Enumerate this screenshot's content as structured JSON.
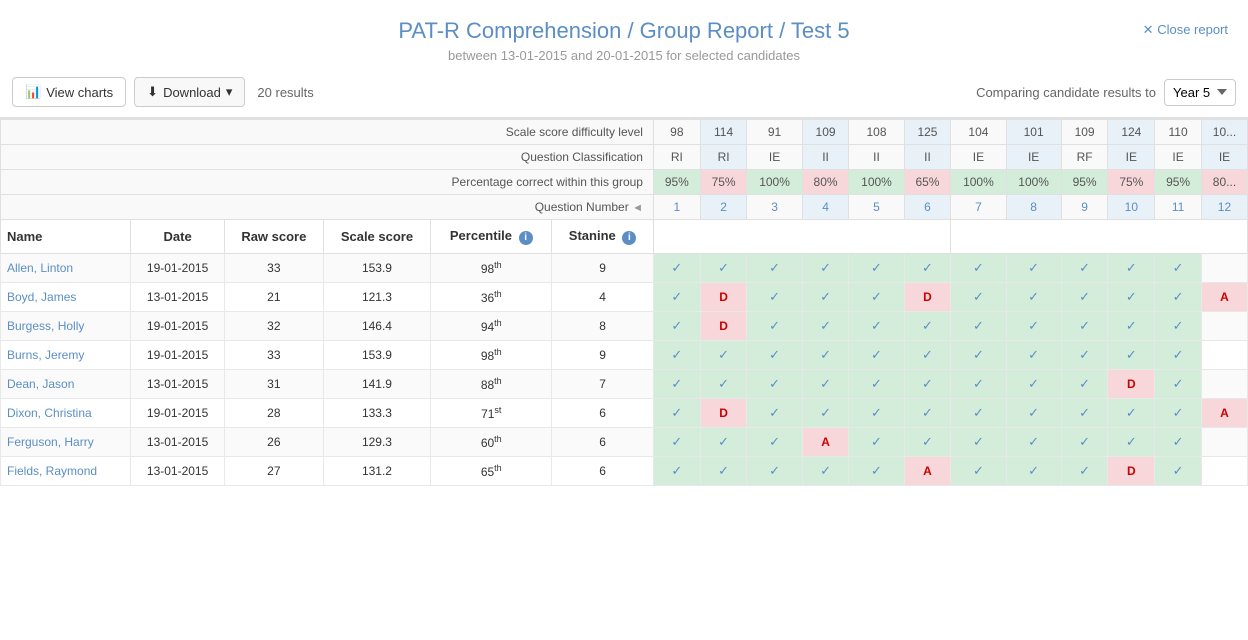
{
  "header": {
    "title": "PAT-R Comprehension / Group Report / Test 5",
    "subtitle": "between 13-01-2015 and 20-01-2015 for selected candidates",
    "close_label": "Close report"
  },
  "toolbar": {
    "view_charts_label": "View charts",
    "download_label": "Download",
    "results_count": "20 results",
    "compare_label": "Comparing candidate results to",
    "compare_value": "Year 5"
  },
  "table": {
    "meta_rows": {
      "scale_score_label": "Scale score difficulty level",
      "question_class_label": "Question Classification",
      "pct_correct_label": "Percentage correct within this group",
      "question_num_label": "Question Number"
    },
    "col_headers": [
      "Name",
      "Date",
      "Raw score",
      "Scale score",
      "Percentile",
      "Stanine"
    ],
    "scale_scores": [
      "98",
      "114",
      "91",
      "109",
      "108",
      "125",
      "104",
      "101",
      "109",
      "124",
      "110",
      "10"
    ],
    "classifications": [
      "RI",
      "RI",
      "IE",
      "II",
      "II",
      "II",
      "IE",
      "IE",
      "RF",
      "IE",
      "IE",
      "IE"
    ],
    "pct_correct": [
      "95%",
      "75%",
      "100%",
      "80%",
      "100%",
      "65%",
      "100%",
      "100%",
      "95%",
      "75%",
      "95%",
      "80"
    ],
    "question_nums": [
      "1",
      "2",
      "3",
      "4",
      "5",
      "6",
      "7",
      "8",
      "9",
      "10",
      "11",
      "12"
    ],
    "rows": [
      {
        "name": "Allen, Linton",
        "date": "19-01-2015",
        "raw": "33",
        "scale": "153.9",
        "percentile": "98th",
        "stanine": "9",
        "answers": [
          "✓",
          "✓",
          "✓",
          "✓",
          "✓",
          "✓",
          "✓",
          "✓",
          "✓",
          "✓",
          "✓",
          "✓"
        ],
        "styles": [
          "",
          "green",
          "green",
          "green",
          "green",
          "green",
          "green",
          "green",
          "green",
          "green",
          "green",
          "green"
        ]
      },
      {
        "name": "Boyd, James",
        "date": "13-01-2015",
        "raw": "21",
        "scale": "121.3",
        "percentile": "36th",
        "stanine": "4",
        "answers": [
          "✓",
          "D",
          "✓",
          "✓",
          "✓",
          "D",
          "✓",
          "✓",
          "✓",
          "✓",
          "✓",
          "A"
        ],
        "styles": [
          "",
          "pink",
          "green",
          "green",
          "green",
          "pink",
          "green",
          "green",
          "green",
          "green",
          "green",
          "pink"
        ]
      },
      {
        "name": "Burgess, Holly",
        "date": "19-01-2015",
        "raw": "32",
        "scale": "146.4",
        "percentile": "94th",
        "stanine": "8",
        "answers": [
          "✓",
          "D",
          "✓",
          "✓",
          "✓",
          "✓",
          "✓",
          "✓",
          "✓",
          "✓",
          "✓",
          ""
        ],
        "styles": [
          "",
          "pink",
          "green",
          "green",
          "green",
          "green",
          "green",
          "green",
          "green",
          "green",
          "green",
          ""
        ]
      },
      {
        "name": "Burns, Jeremy",
        "date": "19-01-2015",
        "raw": "33",
        "scale": "153.9",
        "percentile": "98th",
        "stanine": "9",
        "answers": [
          "✓",
          "✓",
          "✓",
          "✓",
          "✓",
          "✓",
          "✓",
          "✓",
          "✓",
          "✓",
          "✓",
          ""
        ],
        "styles": [
          "",
          "green",
          "green",
          "green",
          "green",
          "green",
          "green",
          "green",
          "green",
          "green",
          "green",
          ""
        ]
      },
      {
        "name": "Dean, Jason",
        "date": "13-01-2015",
        "raw": "31",
        "scale": "141.9",
        "percentile": "88th",
        "stanine": "7",
        "answers": [
          "✓",
          "✓",
          "✓",
          "✓",
          "✓",
          "✓",
          "✓",
          "✓",
          "✓",
          "D",
          "✓",
          ""
        ],
        "styles": [
          "",
          "green",
          "green",
          "green",
          "green",
          "green",
          "green",
          "green",
          "green",
          "pink",
          "green",
          ""
        ]
      },
      {
        "name": "Dixon, Christina",
        "date": "19-01-2015",
        "raw": "28",
        "scale": "133.3",
        "percentile": "71st",
        "stanine": "6",
        "answers": [
          "✓",
          "D",
          "✓",
          "✓",
          "✓",
          "✓",
          "✓",
          "✓",
          "✓",
          "✓",
          "✓",
          "A"
        ],
        "styles": [
          "",
          "pink",
          "green",
          "green",
          "green",
          "green",
          "green",
          "green",
          "green",
          "green",
          "green",
          "pink"
        ]
      },
      {
        "name": "Ferguson, Harry",
        "date": "13-01-2015",
        "raw": "26",
        "scale": "129.3",
        "percentile": "60th",
        "stanine": "6",
        "answers": [
          "✓",
          "✓",
          "✓",
          "A",
          "✓",
          "✓",
          "✓",
          "✓",
          "✓",
          "✓",
          "✓",
          ""
        ],
        "styles": [
          "",
          "green",
          "green",
          "pink",
          "green",
          "green",
          "green",
          "green",
          "green",
          "green",
          "green",
          ""
        ]
      },
      {
        "name": "Fields, Raymond",
        "date": "13-01-2015",
        "raw": "27",
        "scale": "131.2",
        "percentile": "65th",
        "stanine": "6",
        "answers": [
          "✓",
          "✓",
          "✓",
          "✓",
          "✓",
          "A",
          "✓",
          "✓",
          "✓",
          "D",
          "✓",
          ""
        ],
        "styles": [
          "",
          "green",
          "green",
          "green",
          "green",
          "pink",
          "green",
          "green",
          "green",
          "pink",
          "green",
          ""
        ]
      }
    ]
  }
}
